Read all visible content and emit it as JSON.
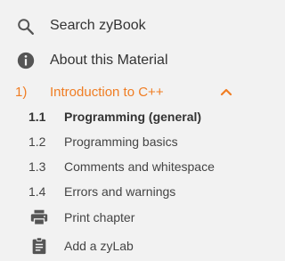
{
  "menu": {
    "search_label": "Search zyBook",
    "about_label": "About this Material"
  },
  "chapter": {
    "number": "1)",
    "title": "Introduction to C++",
    "expanded": true,
    "accent_color": "#f07d23"
  },
  "sections": [
    {
      "number": "1.1",
      "title": "Programming (general)",
      "active": true
    },
    {
      "number": "1.2",
      "title": "Programming basics",
      "active": false
    },
    {
      "number": "1.3",
      "title": "Comments and whitespace",
      "active": false
    },
    {
      "number": "1.4",
      "title": "Errors and warnings",
      "active": false
    }
  ],
  "actions": {
    "print_label": "Print chapter",
    "zylab_label": "Add a zyLab"
  },
  "icons": {
    "search": "search-icon",
    "about": "info-icon",
    "chevron": "chevron-up-icon",
    "print": "printer-icon",
    "zylab": "clipboard-icon"
  }
}
